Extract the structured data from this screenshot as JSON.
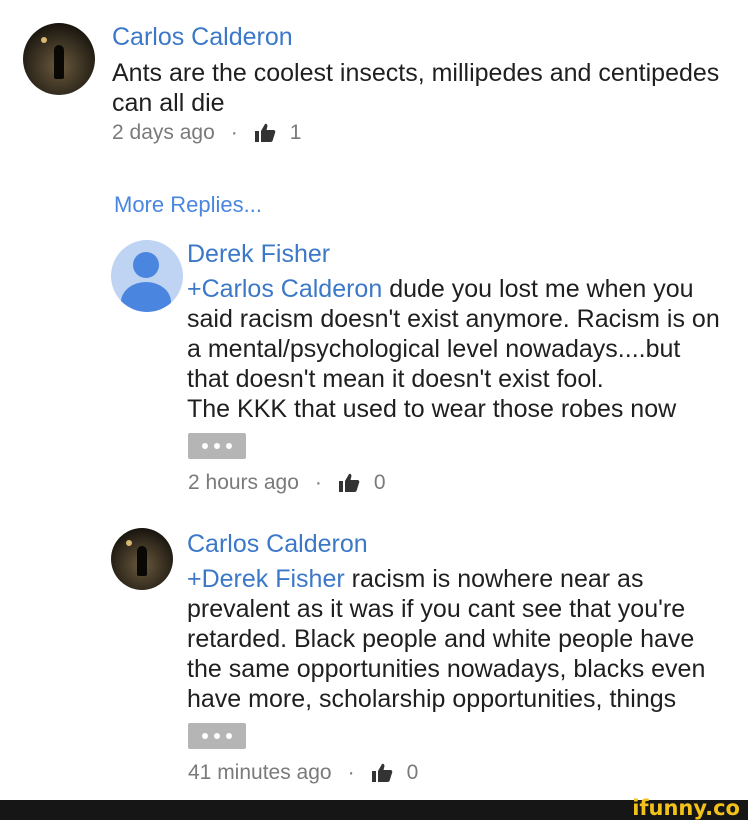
{
  "comments": [
    {
      "author": "Carlos Calderon",
      "mention": "",
      "text_lines": [
        "Ants are the coolest insects, millipedes and centipedes",
        "can all die"
      ],
      "time": "2 days ago",
      "likes": "1"
    },
    {
      "author": "Derek Fisher",
      "mention": "+Carlos Calderon",
      "text_first": "dude you lost me when you",
      "text_lines": [
        "said racism doesn't exist anymore. Racism is on",
        "a mental/psychological level nowadays....but",
        "that doesn't mean it doesn't exist fool.",
        "The KKK that used to wear those robes now"
      ],
      "time": "2 hours ago",
      "likes": "0"
    },
    {
      "author": "Carlos Calderon",
      "mention": "+Derek Fisher",
      "text_first": "racism is nowhere near as",
      "text_lines": [
        "prevalent as it was if you cant see that you're",
        "retarded. Black people and white people have",
        "the same opportunities nowadays, blacks even",
        "have more,  scholarship opportunities, things"
      ],
      "time": "41 minutes ago",
      "likes": "0"
    }
  ],
  "more_replies": "More Replies...",
  "separator": "·",
  "watermark": "ifunny.co",
  "colors": {
    "link": "#3b78c8",
    "meta": "#7a7a7a",
    "footer": "#161616",
    "watermark": "#f2c21a"
  }
}
